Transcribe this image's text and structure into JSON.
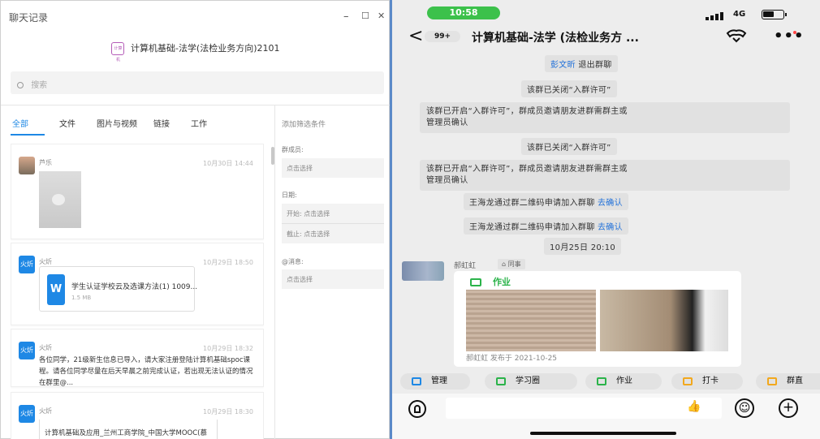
{
  "left": {
    "window_title": "聊天记录",
    "controls": {
      "minimize": "–",
      "maximize": "☐",
      "close": "✕"
    },
    "group_avatar_text": "计算机",
    "group_name": "计算机基础-法学(法检业务方向)2101",
    "search_placeholder": "搜索",
    "tabs": [
      "全部",
      "文件",
      "图片与视频",
      "链接",
      "工作"
    ],
    "feed": [
      {
        "sender": "芦乐",
        "time": "10月30日 14:44"
      },
      {
        "sender": "火炘",
        "time": "10月29日 18:50",
        "file_name": "学生认证学校云及选课方法(1) 1009...",
        "file_icon": "W",
        "file_size": "1.5 MB"
      },
      {
        "sender": "火炘",
        "time": "10月29日 18:32",
        "text": "各位同学，21级新生信息已导入，请大家注册登陆计算机基础spoc课程。请各位同学尽量在后天早晨之前完成认证，若出现无法认证的情况在群里@..."
      },
      {
        "sender": "火炘",
        "time": "10月29日 18:30",
        "text": "计算机基础及应用_兰州工商学院_中国大学MOOC(慕"
      }
    ],
    "avatar_text": "火炘",
    "filter": {
      "title": "添加筛选条件",
      "member_label": "群成员:",
      "member_value": "点击选择",
      "date_label": "日期:",
      "start": "开始: 点击选择",
      "end": "截止: 点击选择",
      "at_label": "@消息:",
      "at_value": "点击选择"
    }
  },
  "right": {
    "time": "10:58",
    "network": "4G",
    "battery_level": 0.6,
    "back_icon": "<",
    "unread": "99+",
    "chat_title": "计算机基础-法学 (法检业务方 ...",
    "more_icon": "•••",
    "sys_msgs": [
      {
        "hl": "彭文昕",
        "rest": " 退出群聊"
      },
      {
        "text": "该群已关闭“入群许可”"
      },
      {
        "line1": "该群已开启“入群许可”，群成员邀请朋友进群需群主或",
        "line2": "管理员确认"
      },
      {
        "text": "该群已关闭“入群许可”"
      },
      {
        "line1": "该群已开启“入群许可”，群成员邀请朋友进群需群主或",
        "line2": "管理员确认"
      },
      {
        "text": "王海龙通过群二维码申请加入群聊 ",
        "hl": "去确认"
      },
      {
        "text": "王海龙通过群二维码申请加入群聊 ",
        "hl": "去确认"
      },
      {
        "text": "10月25日 20:10"
      }
    ],
    "sender": "郝虹虹",
    "sender_tag": "同事",
    "card_title": "作业",
    "card_by": "郝虹虹 发布于 2021-10-25",
    "apps": [
      {
        "label": "管理",
        "color": "#1e88e5"
      },
      {
        "label": "学习圈",
        "color": "#2bb34a"
      },
      {
        "label": "作业",
        "color": "#2bb34a"
      },
      {
        "label": "打卡",
        "color": "#f2a81d"
      },
      {
        "label": "群直",
        "color": "#f2a81d"
      }
    ],
    "thumbs_icon": "👍",
    "emoji_icon": "☺",
    "plus_icon": "+"
  }
}
